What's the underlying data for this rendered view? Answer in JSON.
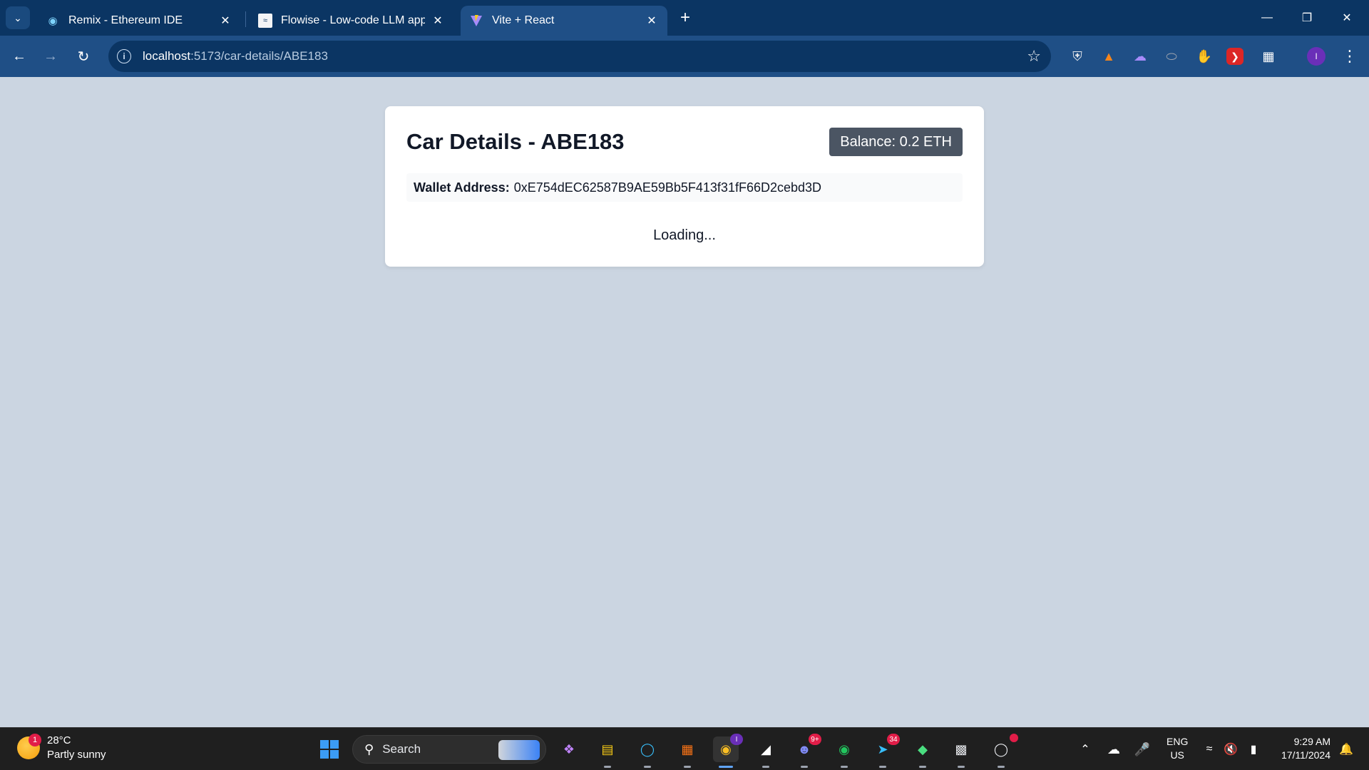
{
  "browser": {
    "tabs": [
      {
        "title": "Remix - Ethereum IDE",
        "active": false
      },
      {
        "title": "Flowise - Low-code LLM apps b",
        "active": false
      },
      {
        "title": "Vite + React",
        "active": true
      }
    ],
    "url_host": "localhost",
    "url_path": ":5173/car-details/ABE183"
  },
  "page": {
    "title": "Car Details - ABE183",
    "balance": "Balance: 0.2 ETH",
    "wallet_label": "Wallet Address:",
    "wallet_address": "0xE754dEC62587B9AE59Bb5F413f31fF66D2cebd3D",
    "loading": "Loading..."
  },
  "taskbar": {
    "weather_temp": "28°C",
    "weather_desc": "Partly sunny",
    "weather_badge": "1",
    "search_label": "Search",
    "chrome_badge": "I",
    "discord_badge": "9+",
    "telegram_badge": "34",
    "lang_top": "ENG",
    "lang_bottom": "US",
    "time": "9:29 AM",
    "date": "17/11/2024"
  },
  "profile_initial": "I",
  "colors": {
    "page_bg": "#cbd5e1",
    "chrome_dark": "#0b3563",
    "chrome_light": "#1f4f86",
    "balance_bg": "#4b5563"
  }
}
